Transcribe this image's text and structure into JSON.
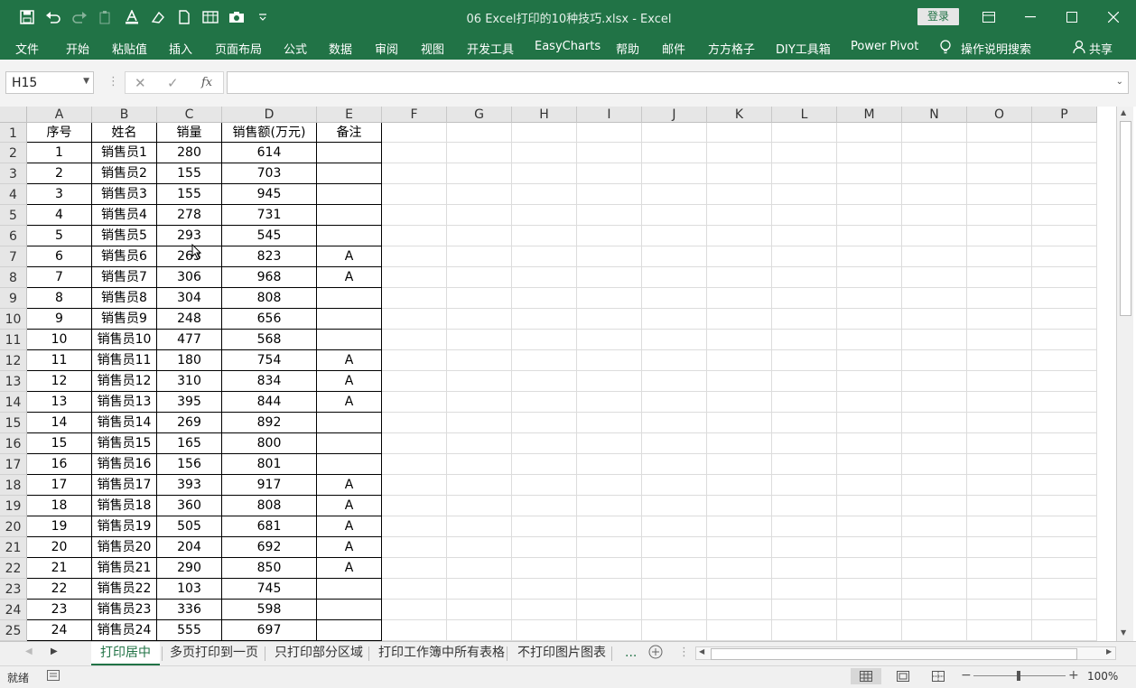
{
  "window": {
    "title": "06 Excel打印的10种技巧.xlsx  -  Excel",
    "login_label": "登录"
  },
  "colors": {
    "accent": "#217346"
  },
  "menu": [
    "文件",
    "开始",
    "粘贴值",
    "插入",
    "页面布局",
    "公式",
    "数据",
    "审阅",
    "视图",
    "开发工具",
    "EasyCharts",
    "帮助",
    "邮件",
    "方方格子",
    "DIY工具箱",
    "Power Pivot",
    "操作说明搜索",
    "共享"
  ],
  "formula_bar": {
    "name_box": "H15",
    "fx_label": "fx",
    "content": ""
  },
  "columns": [
    "A",
    "B",
    "C",
    "D",
    "E",
    "F",
    "G",
    "H",
    "I",
    "J",
    "K",
    "L",
    "M",
    "N",
    "O",
    "P"
  ],
  "row_numbers": [
    "1",
    "2",
    "3",
    "4",
    "5",
    "6",
    "7",
    "8",
    "9",
    "10",
    "11",
    "12",
    "13",
    "14",
    "15",
    "16",
    "17",
    "18",
    "19",
    "20",
    "21",
    "22",
    "23",
    "24",
    "25"
  ],
  "table": {
    "header": [
      "序号",
      "姓名",
      "销量",
      "销售额(万元)",
      "备注"
    ],
    "rows": [
      [
        "1",
        "销售员1",
        "280",
        "614",
        ""
      ],
      [
        "2",
        "销售员2",
        "155",
        "703",
        ""
      ],
      [
        "3",
        "销售员3",
        "155",
        "945",
        ""
      ],
      [
        "4",
        "销售员4",
        "278",
        "731",
        ""
      ],
      [
        "5",
        "销售员5",
        "293",
        "545",
        ""
      ],
      [
        "6",
        "销售员6",
        "263",
        "823",
        "A"
      ],
      [
        "7",
        "销售员7",
        "306",
        "968",
        "A"
      ],
      [
        "8",
        "销售员8",
        "304",
        "808",
        ""
      ],
      [
        "9",
        "销售员9",
        "248",
        "656",
        ""
      ],
      [
        "10",
        "销售员10",
        "477",
        "568",
        ""
      ],
      [
        "11",
        "销售员11",
        "180",
        "754",
        "A"
      ],
      [
        "12",
        "销售员12",
        "310",
        "834",
        "A"
      ],
      [
        "13",
        "销售员13",
        "395",
        "844",
        "A"
      ],
      [
        "14",
        "销售员14",
        "269",
        "892",
        ""
      ],
      [
        "15",
        "销售员15",
        "165",
        "800",
        ""
      ],
      [
        "16",
        "销售员16",
        "156",
        "801",
        ""
      ],
      [
        "17",
        "销售员17",
        "393",
        "917",
        "A"
      ],
      [
        "18",
        "销售员18",
        "360",
        "808",
        "A"
      ],
      [
        "19",
        "销售员19",
        "505",
        "681",
        "A"
      ],
      [
        "20",
        "销售员20",
        "204",
        "692",
        "A"
      ],
      [
        "21",
        "销售员21",
        "290",
        "850",
        "A"
      ],
      [
        "22",
        "销售员22",
        "103",
        "745",
        ""
      ],
      [
        "23",
        "销售员23",
        "336",
        "598",
        ""
      ],
      [
        "24",
        "销售员24",
        "555",
        "697",
        ""
      ]
    ]
  },
  "sheet_tabs": [
    "打印居中",
    "多页打印到一页",
    "只打印部分区域",
    "打印工作簿中所有表格",
    "不打印图片图表"
  ],
  "sheet_more": "...",
  "status": {
    "ready": "就绪",
    "zoom": "100%"
  }
}
